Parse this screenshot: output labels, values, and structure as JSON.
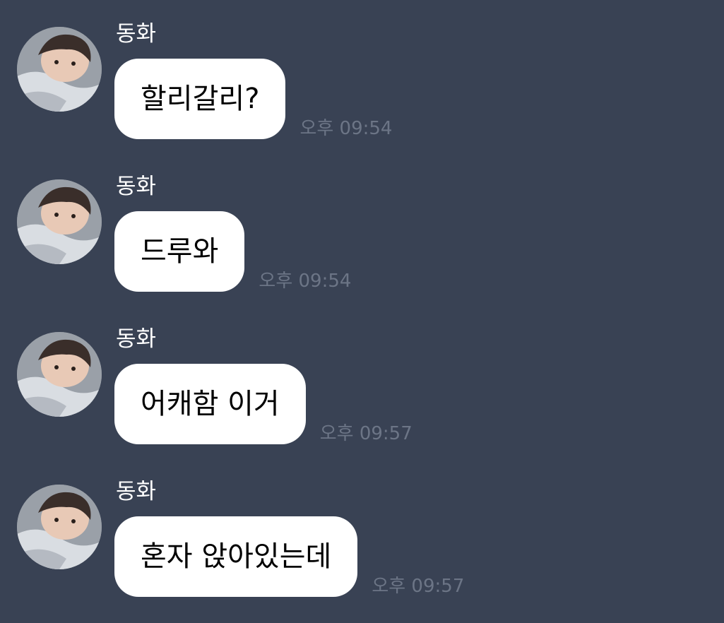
{
  "chat": {
    "messages": [
      {
        "sender": "동화",
        "text": "할리갈리?",
        "time": "오후 09:54"
      },
      {
        "sender": "동화",
        "text": "드루와",
        "time": "오후 09:54"
      },
      {
        "sender": "동화",
        "text": "어캐함 이거",
        "time": "오후 09:57"
      },
      {
        "sender": "동화",
        "text": "혼자 앉아있는데",
        "time": "오후 09:57"
      }
    ]
  },
  "colors": {
    "background": "#394254",
    "bubble": "#ffffff",
    "timestamp": "#6c7586",
    "sender_name": "#ffffff"
  },
  "icons": {
    "avatar": "profile-photo"
  }
}
